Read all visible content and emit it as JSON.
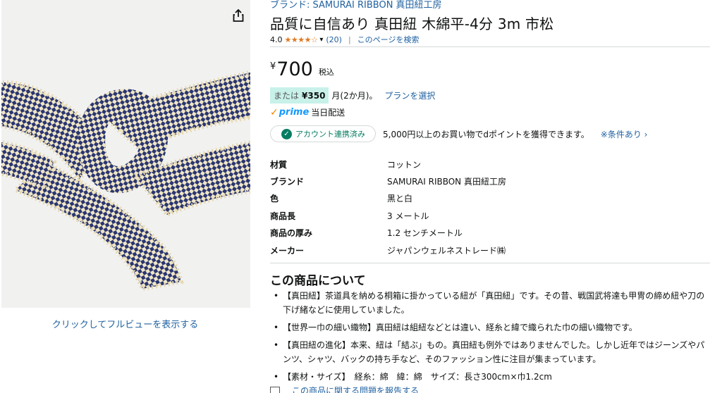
{
  "image_panel": {
    "fullview_label": "クリックしてフルビューを表示する",
    "share_icon": "share-icon"
  },
  "product": {
    "brand_link": "ブランド: SAMURAI RIBBON 真田紐工房",
    "title": "品質に自信あり 真田紐 木綿平-4分 3m 市松",
    "rating": {
      "value": "4.0",
      "stars": 4,
      "max_stars": 5,
      "review_count": "(20)",
      "separator": "|",
      "search_page_link": "このページを検索"
    },
    "price": {
      "symbol": "¥",
      "amount": "700",
      "tax_label": "税込"
    },
    "installment": {
      "or_label": "または",
      "price": "¥350",
      "term": "月(2か月)。",
      "plan_link": "プランを選択"
    },
    "prime": {
      "check": "✓",
      "logo": "prime",
      "delivery": "当日配送"
    },
    "points": {
      "account_label": "アカウント連携済み",
      "points_text": "5,000円以上のお買い物でdポイントを獲得できます。",
      "conditions_link": "※条件あり ›"
    },
    "specs": [
      {
        "key": "材質",
        "value": "コットン"
      },
      {
        "key": "ブランド",
        "value": "SAMURAI RIBBON 真田紐工房"
      },
      {
        "key": "色",
        "value": "黒と白"
      },
      {
        "key": "商品長",
        "value": "3 メートル"
      },
      {
        "key": "商品の厚み",
        "value": "1.2 センチメートル"
      },
      {
        "key": "メーカー",
        "value": "ジャパンウェルネストレード㈱"
      }
    ],
    "about": {
      "heading": "この商品について",
      "bullets": [
        "【真田紐】茶道具を納める桐箱に掛かっている紐が「真田紐」です。その昔、戦国武将達も甲冑の締め紐や刀の下げ緒などに使用していました。",
        "【世界一巾の細い織物】真田紐は組紐などとは違い、経糸と緯で織られた巾の細い織物です。",
        "【真田紐の進化】本来、紐は「結ぶ」もの。真田紐も例外ではありませんでした。しかし近年ではジーンズやパンツ、シャツ、バックの持ち手など、そのファッション性に注目が集まっています。",
        "【素材・サイズ】　経糸：綿　緯：綿　サイズ：長さ300cm×巾1.2cm"
      ]
    },
    "report_link": "この商品に関する問題を報告する"
  },
  "colors": {
    "link": "#2162a1",
    "star": "#de7921",
    "prime": "#1399ff",
    "installment_bg": "#c8f1ea",
    "connected_green": "#067d62",
    "ribbon_navy": "#2b3670",
    "ribbon_cream": "#efe6c8"
  }
}
